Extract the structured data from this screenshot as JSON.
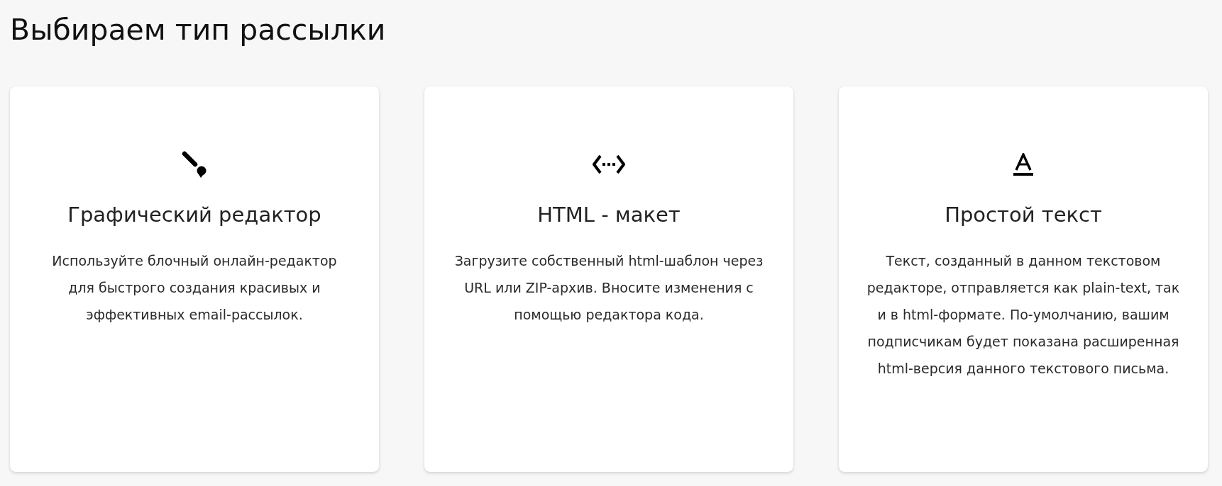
{
  "page": {
    "title": "Выбираем тип рассылки"
  },
  "cards": [
    {
      "kind": "graphic",
      "title": "Графический редактор",
      "description": "Используйте блочный онлайн-редактор для быстрого создания красивых и эффективных email-рассылок."
    },
    {
      "kind": "html",
      "title": "HTML - макет",
      "description": "Загрузите собственный html-шаблон через URL или ZIP-архив. Вносите изменения с помощью редактора кода."
    },
    {
      "kind": "plain",
      "title": "Простой текст",
      "description": "Текст, созданный в данном текстовом редакторе, отправляется как plain-text, так и в html-формате. По-умолчанию, вашим подписчикам будет показана расширенная html-версия данного текстового письма."
    }
  ]
}
